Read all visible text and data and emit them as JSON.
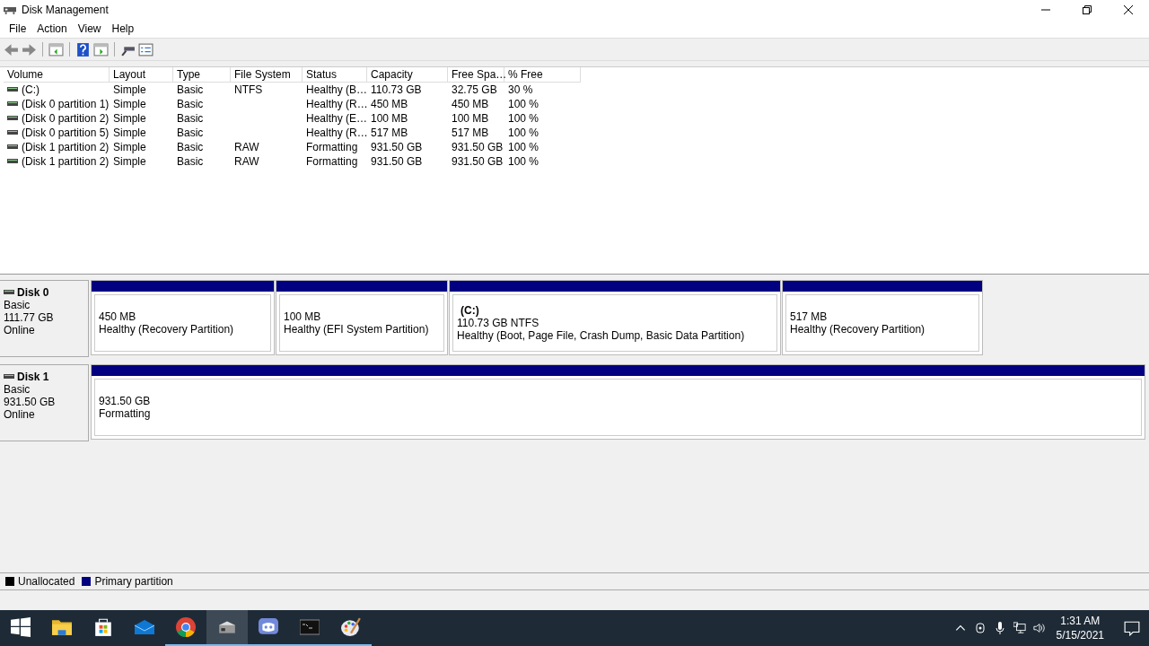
{
  "window": {
    "title": "Disk Management"
  },
  "menu": [
    "File",
    "Action",
    "View",
    "Help"
  ],
  "table": {
    "columns": [
      "Volume",
      "Layout",
      "Type",
      "File System",
      "Status",
      "Capacity",
      "Free Spa…",
      "% Free"
    ],
    "rows": [
      [
        "(C:)",
        "Simple",
        "Basic",
        "NTFS",
        "Healthy (B…",
        "110.73 GB",
        "32.75 GB",
        "30 %"
      ],
      [
        "(Disk 0 partition 1)",
        "Simple",
        "Basic",
        "",
        "Healthy (R…",
        "450 MB",
        "450 MB",
        "100 %"
      ],
      [
        "(Disk 0 partition 2)",
        "Simple",
        "Basic",
        "",
        "Healthy (E…",
        "100 MB",
        "100 MB",
        "100 %"
      ],
      [
        "(Disk 0 partition 5)",
        "Simple",
        "Basic",
        "",
        "Healthy (R…",
        "517 MB",
        "517 MB",
        "100 %"
      ],
      [
        "(Disk 1 partition 2)",
        "Simple",
        "Basic",
        "RAW",
        "Formatting",
        "931.50 GB",
        "931.50 GB",
        "100 %"
      ],
      [
        "(Disk 1 partition 2)",
        "Simple",
        "Basic",
        "RAW",
        "Formatting",
        "931.50 GB",
        "931.50 GB",
        "100 %"
      ]
    ]
  },
  "disks": [
    {
      "name": "Disk 0",
      "type": "Basic",
      "size": "111.77 GB",
      "status": "Online",
      "partitions": [
        {
          "size": "450 MB",
          "status": "Healthy (Recovery Partition)"
        },
        {
          "size": "100 MB",
          "status": "Healthy (EFI System Partition)"
        },
        {
          "label": "(C:)",
          "size": "110.73 GB NTFS",
          "status": "Healthy (Boot, Page File, Crash Dump, Basic Data Partition)"
        },
        {
          "size": "517 MB",
          "status": "Healthy (Recovery Partition)"
        }
      ]
    },
    {
      "name": "Disk 1",
      "type": "Basic",
      "size": "931.50 GB",
      "status": "Online",
      "partitions": [
        {
          "size": "931.50 GB",
          "status": "Formatting"
        }
      ]
    }
  ],
  "legend": [
    {
      "label": "Unallocated",
      "color": "#000000"
    },
    {
      "label": "Primary partition",
      "color": "#000080"
    }
  ],
  "taskbar": {
    "apps": [
      {
        "kind": "start",
        "running": false,
        "selected": false
      },
      {
        "kind": "folder",
        "running": false,
        "selected": false
      },
      {
        "kind": "store",
        "running": false,
        "selected": false
      },
      {
        "kind": "mail",
        "running": false,
        "selected": false
      },
      {
        "kind": "chrome",
        "running": true,
        "selected": false
      },
      {
        "kind": "disk",
        "running": true,
        "selected": true
      },
      {
        "kind": "chat",
        "running": true,
        "selected": false
      },
      {
        "kind": "terminal",
        "running": true,
        "selected": false
      },
      {
        "kind": "paint",
        "running": true,
        "selected": false
      }
    ],
    "time": "1:31 AM",
    "date": "5/15/2021"
  }
}
